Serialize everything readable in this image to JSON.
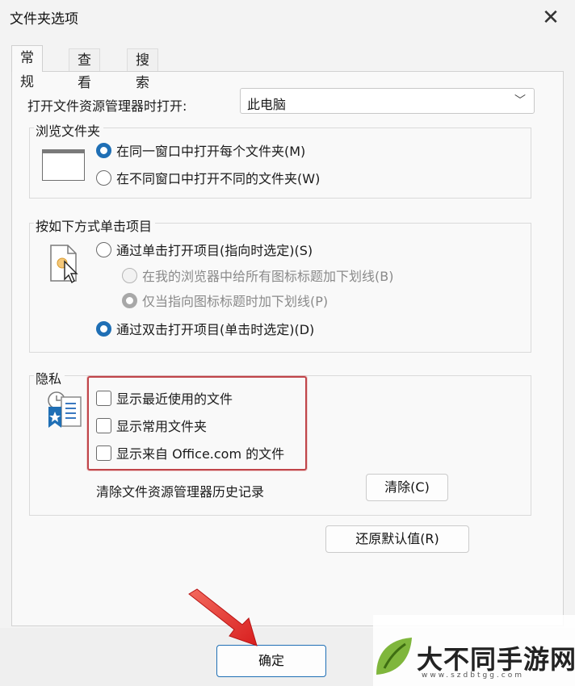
{
  "window": {
    "title": "文件夹选项",
    "close_icon": "close-icon"
  },
  "tabs": [
    {
      "label": "常规",
      "active": true
    },
    {
      "label": "查看",
      "active": false
    },
    {
      "label": "搜索",
      "active": false
    }
  ],
  "open_explorer": {
    "label": "打开文件资源管理器时打开:",
    "selected": "此电脑"
  },
  "browse_folders": {
    "title": "浏览文件夹",
    "options": [
      {
        "label": "在同一窗口中打开每个文件夹(M)",
        "selected": true
      },
      {
        "label": "在不同窗口中打开不同的文件夹(W)",
        "selected": false
      }
    ]
  },
  "click_items": {
    "title": "按如下方式单击项目",
    "options": [
      {
        "label": "通过单击打开项目(指向时选定)(S)",
        "selected": false,
        "disabled": false
      },
      {
        "label": "在我的浏览器中给所有图标标题加下划线(B)",
        "selected": false,
        "disabled": true
      },
      {
        "label": "仅当指向图标标题时加下划线(P)",
        "selected": true,
        "disabled": true
      },
      {
        "label": "通过双击打开项目(单击时选定)(D)",
        "selected": true,
        "disabled": false
      }
    ]
  },
  "privacy": {
    "title": "隐私",
    "checkboxes": [
      {
        "label": "显示最近使用的文件",
        "checked": false
      },
      {
        "label": "显示常用文件夹",
        "checked": false
      },
      {
        "label": "显示来自 Office.com 的文件",
        "checked": false
      }
    ],
    "clear_label": "清除文件资源管理器历史记录",
    "clear_button": "清除(C)"
  },
  "restore_button": "还原默认值(R)",
  "ok_button": "确定",
  "watermark": {
    "text": "大不同手游网",
    "url": "www.szdbtgg.com"
  },
  "colors": {
    "accent": "#1f6fb5",
    "highlight_box": "#c0454a",
    "arrow": "#e03232"
  }
}
